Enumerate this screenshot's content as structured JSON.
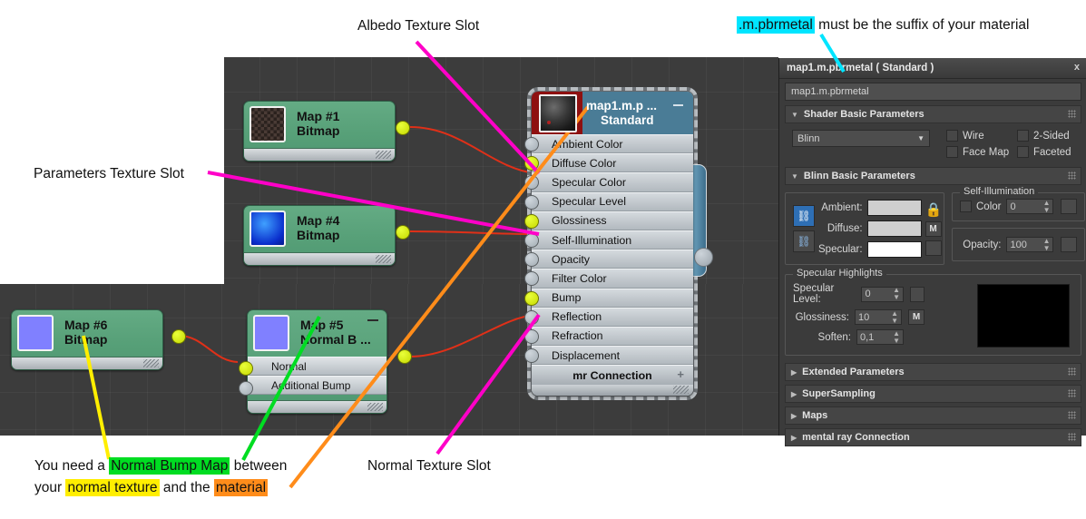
{
  "annotations": {
    "albedo": "Albedo Texture Slot",
    "parameters": "Parameters Texture Slot",
    "normal": "Normal Texture Slot",
    "suffix_chip": ".m.pbrmetal",
    "suffix_rest": "must be the suffix of your material",
    "bottom_line1_a": "You need a",
    "bottom_line1_b": "Normal Bump Map",
    "bottom_line1_c": "between",
    "bottom_line2_a": "your",
    "bottom_line2_b": "normal texture",
    "bottom_line2_c": "and the",
    "bottom_line2_d": "material",
    "colors": {
      "cyan": "#00e5ff",
      "green": "#00dd22",
      "yellow": "#ffee00",
      "orange": "#ff8c1a",
      "magenta": "#ff00c8",
      "red_wire": "#e03018"
    }
  },
  "nodes": {
    "map1": {
      "title": "Map #1",
      "subtitle": "Bitmap"
    },
    "map4": {
      "title": "Map #4",
      "subtitle": "Bitmap"
    },
    "map5": {
      "title": "Map #5",
      "subtitle": "Normal B ...",
      "slots": [
        "Normal",
        "Additional Bump"
      ]
    },
    "map6": {
      "title": "Map #6",
      "subtitle": "Bitmap"
    },
    "material": {
      "title": "map1.m.p ...",
      "subtitle": "Standard",
      "slots": [
        {
          "label": "Ambient Color",
          "connected": false
        },
        {
          "label": "Diffuse Color",
          "connected": true
        },
        {
          "label": "Specular Color",
          "connected": false
        },
        {
          "label": "Specular Level",
          "connected": false
        },
        {
          "label": "Glossiness",
          "connected": true
        },
        {
          "label": "Self-Illumination",
          "connected": false
        },
        {
          "label": "Opacity",
          "connected": false
        },
        {
          "label": "Filter Color",
          "connected": false
        },
        {
          "label": "Bump",
          "connected": true
        },
        {
          "label": "Reflection",
          "connected": false
        },
        {
          "label": "Refraction",
          "connected": false
        },
        {
          "label": "Displacement",
          "connected": false
        }
      ],
      "mr_connection": "mr Connection",
      "mr_plus": "+"
    }
  },
  "panel": {
    "title": "map1.m.pbrmetal  ( Standard )",
    "close": "x",
    "name_value": "map1.m.pbrmetal",
    "shader_basic": {
      "header": "Shader Basic Parameters",
      "shader_type": "Blinn",
      "checkboxes": [
        "Wire",
        "2-Sided",
        "Face Map",
        "Faceted"
      ]
    },
    "blinn_basic": {
      "header": "Blinn Basic Parameters",
      "ambient_label": "Ambient:",
      "ambient_color": "#cfcfcf",
      "diffuse_label": "Diffuse:",
      "diffuse_color": "#cfcfcf",
      "diffuse_map_btn": "M",
      "specular_label": "Specular:",
      "specular_color": "#ffffff",
      "self_illum_label": "Self-Illumination",
      "self_illum_color_label": "Color",
      "self_illum_value": "0",
      "opacity_label": "Opacity:",
      "opacity_value": "100",
      "spec_highlights_label": "Specular Highlights",
      "specular_level_label": "Specular Level:",
      "specular_level_value": "0",
      "glossiness_label": "Glossiness:",
      "glossiness_value": "10",
      "glossiness_map_btn": "M",
      "soften_label": "Soften:",
      "soften_value": "0,1",
      "preview_color": "#000000"
    },
    "rollups": [
      "Extended Parameters",
      "SuperSampling",
      "Maps",
      "mental ray Connection"
    ]
  }
}
